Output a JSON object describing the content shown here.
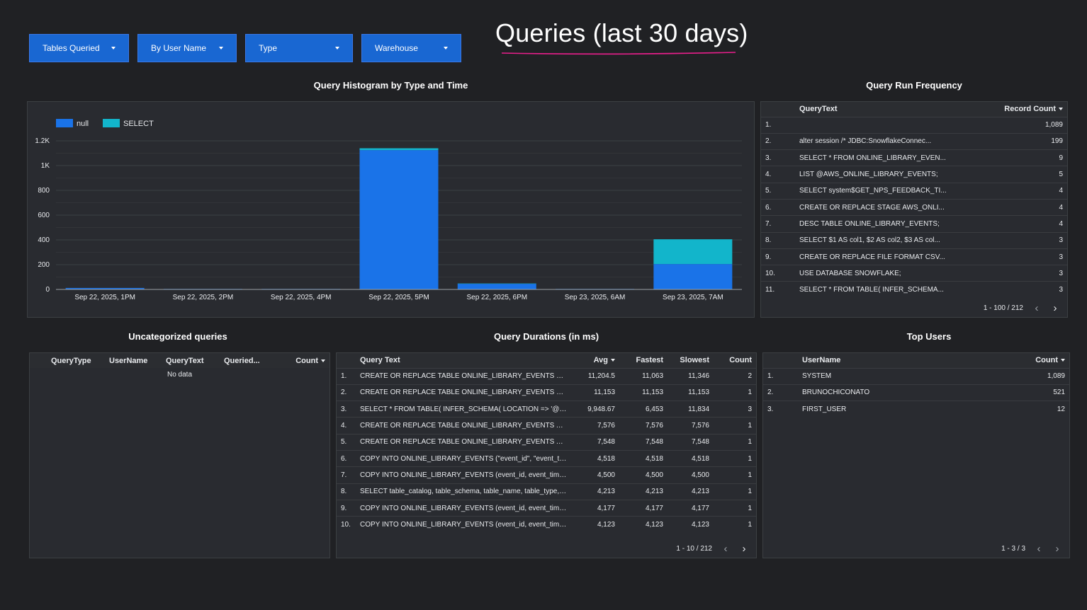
{
  "filters": [
    "Tables Queried",
    "By User Name",
    "Type",
    "Warehouse"
  ],
  "title": "Queries (last 30 days)",
  "colors": {
    "null": "#1a73e8",
    "select": "#12b5cb",
    "accent": "#e91e8c"
  },
  "histogram": {
    "title": "Query Histogram by Type and Time",
    "legend": [
      "null",
      "SELECT"
    ]
  },
  "chart_data": {
    "type": "bar",
    "stacked": true,
    "categories": [
      "Sep 22, 2025, 1PM",
      "Sep 22, 2025, 2PM",
      "Sep 22, 2025, 4PM",
      "Sep 22, 2025, 5PM",
      "Sep 22, 2025, 6PM",
      "Sep 23, 2025, 6AM",
      "Sep 23, 2025, 7AM"
    ],
    "series": [
      {
        "name": "null",
        "values": [
          12,
          4,
          4,
          1125,
          45,
          4,
          205
        ]
      },
      {
        "name": "SELECT",
        "values": [
          0,
          0,
          0,
          15,
          3,
          0,
          200
        ]
      }
    ],
    "yticks": [
      "0",
      "200",
      "400",
      "600",
      "800",
      "1K",
      "1.2K"
    ],
    "ylim": [
      0,
      1200
    ],
    "legend_position": "top-left",
    "grid": true
  },
  "runfreq": {
    "title": "Query Run Frequency",
    "headers": [
      "QueryText",
      "Record Count"
    ],
    "rows": [
      [
        "1.",
        "",
        "1,089"
      ],
      [
        "2.",
        "alter session /* JDBC:SnowflakeConnec...",
        "199"
      ],
      [
        "3.",
        "SELECT * FROM ONLINE_LIBRARY_EVEN...",
        "9"
      ],
      [
        "4.",
        "LIST @AWS_ONLINE_LIBRARY_EVENTS;",
        "5"
      ],
      [
        "5.",
        "SELECT system$GET_NPS_FEEDBACK_TI...",
        "4"
      ],
      [
        "6.",
        "CREATE OR REPLACE STAGE AWS_ONLI...",
        "4"
      ],
      [
        "7.",
        "DESC TABLE ONLINE_LIBRARY_EVENTS;",
        "4"
      ],
      [
        "8.",
        "SELECT $1 AS col1, $2 AS col2, $3 AS col...",
        "3"
      ],
      [
        "9.",
        "CREATE OR REPLACE FILE FORMAT CSV...",
        "3"
      ],
      [
        "10.",
        "USE DATABASE SNOWFLAKE;",
        "3"
      ],
      [
        "11.",
        "SELECT * FROM TABLE( INFER_SCHEMA...",
        "3"
      ]
    ],
    "pager": "1 - 100 / 212"
  },
  "uncat": {
    "title": "Uncategorized queries",
    "headers": [
      "QueryType",
      "UserName",
      "QueryText",
      "Queried...",
      "Count"
    ],
    "empty": "No data"
  },
  "durations": {
    "title": "Query Durations (in ms)",
    "headers": [
      "Query Text",
      "Avg",
      "Fastest",
      "Slowest",
      "Count"
    ],
    "rows": [
      [
        "1.",
        "CREATE OR REPLACE TABLE ONLINE_LIBRARY_EVENTS USING TEMPL...",
        "11,204.5",
        "11,063",
        "11,346",
        "2"
      ],
      [
        "2.",
        "CREATE OR REPLACE TABLE ONLINE_LIBRARY_EVENTS USING TEMPL...",
        "11,153",
        "11,153",
        "11,153",
        "1"
      ],
      [
        "3.",
        "SELECT * FROM TABLE( INFER_SCHEMA( LOCATION => '@AWS_ONLI...",
        "9,948.67",
        "6,453",
        "11,834",
        "3"
      ],
      [
        "4.",
        "CREATE OR REPLACE TABLE ONLINE_LIBRARY_EVENTS AS SELECT $1:...",
        "7,576",
        "7,576",
        "7,576",
        "1"
      ],
      [
        "5.",
        "CREATE OR REPLACE TABLE ONLINE_LIBRARY_EVENTS AS SELECT $1:...",
        "7,548",
        "7,548",
        "7,548",
        "1"
      ],
      [
        "6.",
        "COPY INTO ONLINE_LIBRARY_EVENTS (\"event_id\", \"event_timestamp\",...",
        "4,518",
        "4,518",
        "4,518",
        "1"
      ],
      [
        "7.",
        "COPY INTO ONLINE_LIBRARY_EVENTS (event_id, event_timestamp, e...",
        "4,500",
        "4,500",
        "4,500",
        "1"
      ],
      [
        "8.",
        "SELECT table_catalog, table_schema, table_name, table_type, row_c...",
        "4,213",
        "4,213",
        "4,213",
        "1"
      ],
      [
        "9.",
        "COPY INTO ONLINE_LIBRARY_EVENTS (event_id, event_timestamp, e...",
        "4,177",
        "4,177",
        "4,177",
        "1"
      ],
      [
        "10.",
        "COPY INTO ONLINE_LIBRARY_EVENTS (event_id, event_timestamp, e...",
        "4,123",
        "4,123",
        "4,123",
        "1"
      ]
    ],
    "pager": "1 - 10 / 212"
  },
  "topusers": {
    "title": "Top Users",
    "headers": [
      "UserName",
      "Count"
    ],
    "rows": [
      [
        "1.",
        "SYSTEM",
        "1,089"
      ],
      [
        "2.",
        "BRUNOCHICONATO",
        "521"
      ],
      [
        "3.",
        "FIRST_USER",
        "12"
      ]
    ],
    "pager": "1 - 3 / 3"
  },
  "icons": {
    "prev": "chevron-left-icon",
    "next": "chevron-right-icon",
    "dropdown": "caret-down-icon"
  }
}
